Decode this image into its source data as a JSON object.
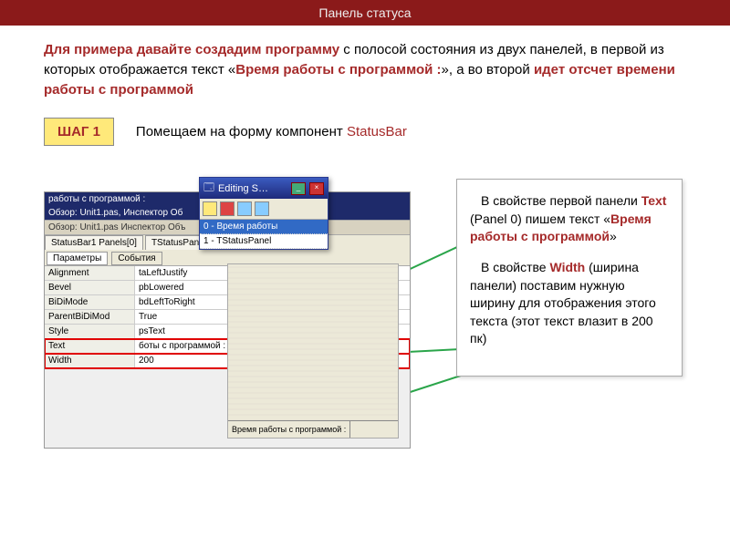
{
  "title": "Панель статуса",
  "intro": {
    "lead": "Для примера давайте создадим программу",
    "rest1": " с полосой состояния из двух панелей, в первой из которых отображается текст «",
    "quoted": "Время работы с программой :",
    "rest2": "», а во второй ",
    "tail": "идет отсчет времени работы с программой"
  },
  "step": {
    "label": "ШАГ 1",
    "text": "Помещаем на форму компонент ",
    "component": "StatusBar"
  },
  "note": {
    "p1a": "В свойстве первой панели ",
    "p1b": "Text",
    "p1c": " (Panel 0) пишем текст «",
    "p1d": "Время работы с программой",
    "p1e": "»",
    "p2a": "В свойстве ",
    "p2b": "Width",
    "p2c": " (ширина панели) поставим нужную ширину для отображения этого текста (этот текст влазит в 200 пк)"
  },
  "shot": {
    "top": "работы с программой :",
    "bar1": "Обзор: Unit1.pas, Инспектор Об",
    "bar2": "Обзор: Unit1.pas    Инспектор Объ",
    "tab1": "StatusBar1 Panels[0]",
    "tab2": "TStatusPanel",
    "sub1": "Параметры",
    "sub2": "События",
    "props": [
      {
        "k": "Alignment",
        "v": "taLeftJustify"
      },
      {
        "k": "Bevel",
        "v": "pbLowered"
      },
      {
        "k": "BiDiMode",
        "v": "bdLeftToRight"
      },
      {
        "k": "ParentBiDiMod",
        "v": "True"
      },
      {
        "k": "Style",
        "v": "psText"
      },
      {
        "k": "Text",
        "v": "боты с программой :",
        "hl": true
      },
      {
        "k": "Width",
        "v": "200",
        "hl": true
      }
    ],
    "status_label": "Время работы с программой :"
  },
  "popup": {
    "title": "Editing S…",
    "items": [
      "0 - Время работы",
      "1 - TStatusPanel"
    ]
  }
}
